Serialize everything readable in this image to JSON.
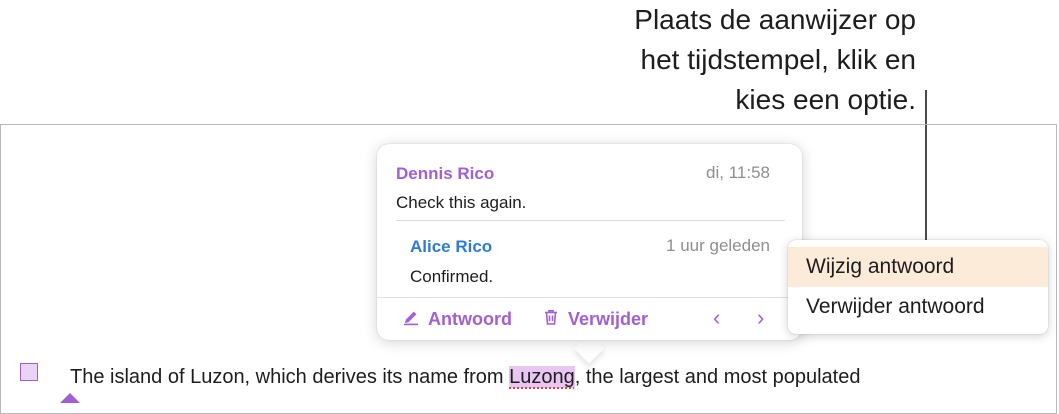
{
  "callout": {
    "line1": "Plaats de aanwijzer op",
    "line2": "het tijdstempel, klik en",
    "line3": "kies een optie."
  },
  "document": {
    "text_before": "The island of Luzon, which derives its name from ",
    "highlighted_word": "Luzong",
    "text_after": ", the largest and most populated"
  },
  "popover": {
    "comment1": {
      "author": "Dennis Rico",
      "time": "di, 11:58",
      "text": "Check this again."
    },
    "comment2": {
      "author": "Alice Rico",
      "time": "1 uur geleden",
      "text": "Confirmed."
    },
    "reply_label": "Antwoord",
    "delete_label": "Verwijder",
    "prev_glyph": "‹",
    "next_glyph": "›"
  },
  "menu": {
    "items": [
      {
        "label": "Wijzig antwoord",
        "active": true
      },
      {
        "label": "Verwijder antwoord",
        "active": false
      }
    ]
  },
  "colors": {
    "author1": "#a15fd6",
    "author2": "#2e7bd6",
    "accent": "#a15fd6",
    "highlight": "#e9c6f2",
    "menu_active": "#fcebd9"
  }
}
